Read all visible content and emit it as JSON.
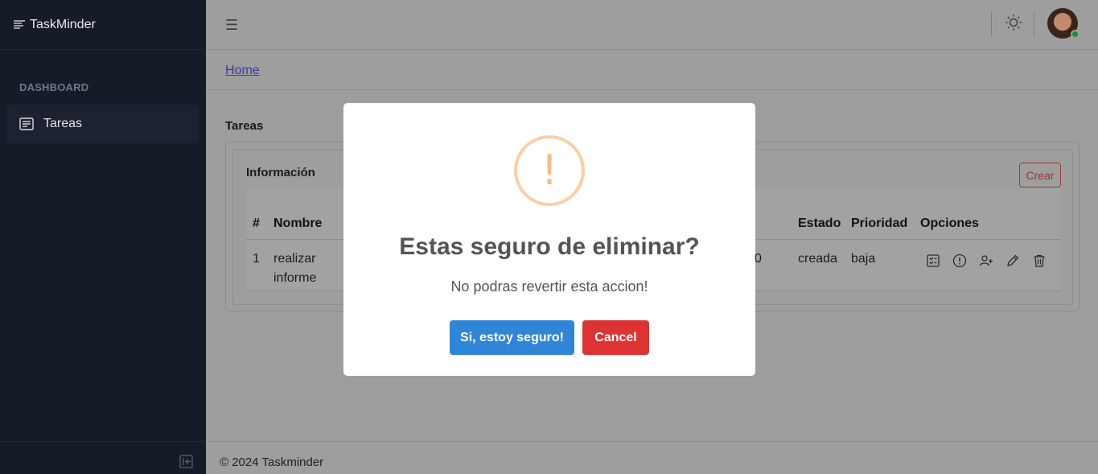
{
  "app": {
    "brand": "TaskMinder"
  },
  "sidebar": {
    "section": "DASHBOARD",
    "items": [
      {
        "label": "Tareas",
        "icon": "list-icon"
      }
    ]
  },
  "breadcrumb": {
    "home": "Home"
  },
  "page": {
    "title": "Tareas"
  },
  "card": {
    "title": "Información",
    "create_label": "Crear",
    "columns": [
      "#",
      "Nombre",
      "Estado",
      "Prioridad",
      "Opciones"
    ],
    "rows": [
      {
        "num": "1",
        "name_line1": "realizar",
        "name_line2": "informe",
        "partial": "0",
        "estado": "creada",
        "prioridad": "baja"
      }
    ]
  },
  "footer": {
    "text": "© 2024 Taskminder"
  },
  "modal": {
    "title": "Estas seguro de eliminar?",
    "text": "No podras revertir esta accion!",
    "confirm_label": "Si, estoy seguro!",
    "cancel_label": "Cancel",
    "icon": "!",
    "colors": {
      "confirm": "#3085d6",
      "cancel": "#dd3333",
      "warning": "#f8bb86"
    }
  }
}
